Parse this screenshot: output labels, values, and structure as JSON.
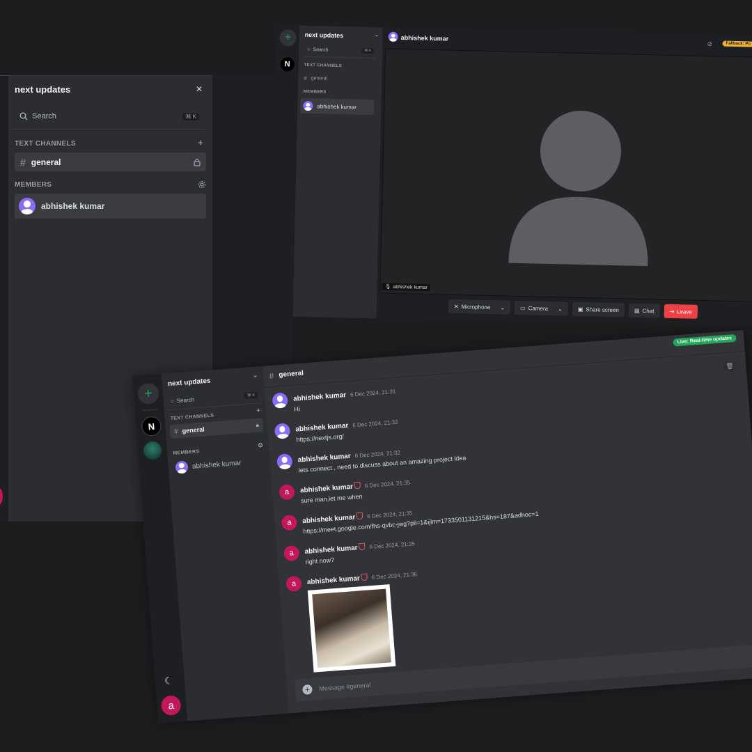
{
  "server_name": "next updates",
  "search": {
    "label": "Search",
    "shortcut": "⌘ K"
  },
  "sections": {
    "text_channels": "TEXT CHANNELS",
    "members": "MEMBERS"
  },
  "channel": {
    "name": "general",
    "hash": "#"
  },
  "member": {
    "name": "abhishek kumar"
  },
  "server_icon_letter": "N",
  "video": {
    "participant": "abhishek kumar",
    "tile_label": "abhishek kumar",
    "fallback_badge": "Fallback: Po",
    "controls": {
      "microphone": "Microphone",
      "camera": "Camera",
      "share_screen": "Share screen",
      "chat": "Chat",
      "leave": "Leave"
    }
  },
  "chat": {
    "header": "general",
    "live_badge": "Live: Real-time updates",
    "input_placeholder": "Message #general",
    "user_initial": "a",
    "messages": [
      {
        "author": "abhishek kumar",
        "time": "6 Dec 2024, 21:31",
        "text": "Hi"
      },
      {
        "author": "abhishek kumar",
        "time": "6 Dec 2024, 21:32",
        "text": "https://nextjs.org/"
      },
      {
        "author": "abhishek kumar",
        "time": "6 Dec 2024, 21:32",
        "text": "lets connect , need to discuss about an amazing project idea"
      },
      {
        "author": "abhishek kumar",
        "time": "6 Dec 2024, 21:35",
        "text": "sure man,let me when"
      },
      {
        "author": "abhishek kumar",
        "time": "6 Dec 2024, 21:35",
        "text": "https://meet.google.com/fhs-qvbc-jwg?pli=1&ijlm=1733501131215&hs=187&adhoc=1"
      },
      {
        "author": "abhishek kumar",
        "time": "6 Dec 2024, 21:35",
        "text": "right now?"
      },
      {
        "author": "abhishek kumar",
        "time": "6 Dec 2024, 21:36",
        "text": ""
      }
    ]
  },
  "colors": {
    "accent_green": "#23a55a",
    "leave_red": "#ed4245",
    "fallback_yellow": "#f0b232",
    "avatar_purple": "#8b6cf7",
    "avatar_pink": "#c2185b"
  }
}
